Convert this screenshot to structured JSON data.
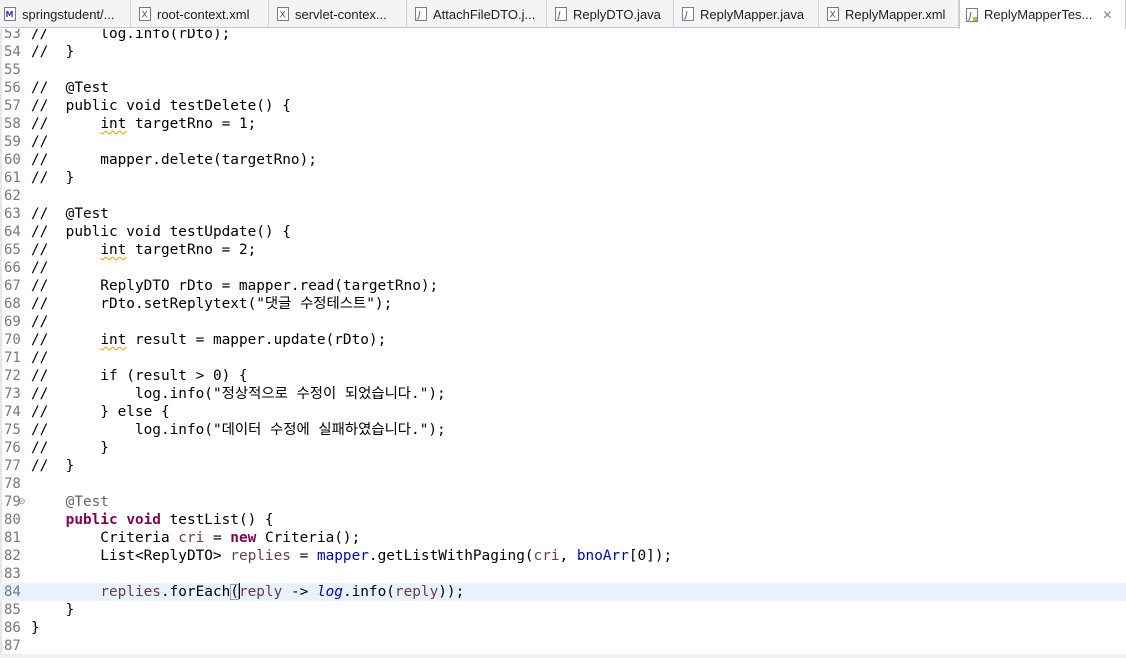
{
  "colors": {
    "keyword": "#7f0055",
    "annotation": "#646464",
    "field": "#0000c0",
    "local_variable": "#6a3e3e",
    "string": "#2a00ff",
    "current_line": "#e8f2fe",
    "line_number": "#787878"
  },
  "tabs": [
    {
      "label": "springstudent/...",
      "icon": "maven-pom-icon",
      "active": false
    },
    {
      "label": "root-context.xml",
      "icon": "xml-file-icon",
      "active": false
    },
    {
      "label": "servlet-contex...",
      "icon": "xml-file-icon",
      "active": false
    },
    {
      "label": "AttachFileDTO.j...",
      "icon": "java-file-icon",
      "active": false
    },
    {
      "label": "ReplyDTO.java",
      "icon": "java-file-icon",
      "active": false
    },
    {
      "label": "ReplyMapper.java",
      "icon": "java-file-icon",
      "active": false
    },
    {
      "label": "ReplyMapper.xml",
      "icon": "xml-file-icon",
      "active": false
    },
    {
      "label": "ReplyMapperTes...",
      "icon": "java-test-file-icon",
      "active": true,
      "close_icon": "close-icon"
    }
  ],
  "editor": {
    "current_line": 84,
    "lines": [
      {
        "n": "53",
        "fold": "",
        "tokens": [
          {
            "t": "//      log.info(rDto);",
            "c": "plain"
          }
        ]
      },
      {
        "n": "54",
        "fold": "",
        "tokens": [
          {
            "t": "//  }",
            "c": "plain"
          }
        ]
      },
      {
        "n": "55",
        "fold": "",
        "tokens": []
      },
      {
        "n": "56",
        "fold": "",
        "tokens": [
          {
            "t": "//  @Test",
            "c": "plain"
          }
        ]
      },
      {
        "n": "57",
        "fold": "",
        "tokens": [
          {
            "t": "//  public void testDelete() {",
            "c": "plain"
          }
        ]
      },
      {
        "n": "58",
        "fold": "",
        "tokens": [
          {
            "t": "//      ",
            "c": "plain"
          },
          {
            "t": "int",
            "c": "warn"
          },
          {
            "t": " targetRno = 1;",
            "c": "plain"
          }
        ]
      },
      {
        "n": "59",
        "fold": "",
        "tokens": [
          {
            "t": "//",
            "c": "plain"
          }
        ]
      },
      {
        "n": "60",
        "fold": "",
        "tokens": [
          {
            "t": "//      mapper.delete(targetRno);",
            "c": "plain"
          }
        ]
      },
      {
        "n": "61",
        "fold": "",
        "tokens": [
          {
            "t": "//  }",
            "c": "plain"
          }
        ]
      },
      {
        "n": "62",
        "fold": "",
        "tokens": []
      },
      {
        "n": "63",
        "fold": "",
        "tokens": [
          {
            "t": "//  @Test",
            "c": "plain"
          }
        ]
      },
      {
        "n": "64",
        "fold": "",
        "tokens": [
          {
            "t": "//  public void testUpdate() {",
            "c": "plain"
          }
        ]
      },
      {
        "n": "65",
        "fold": "",
        "tokens": [
          {
            "t": "//      ",
            "c": "plain"
          },
          {
            "t": "int",
            "c": "warn"
          },
          {
            "t": " targetRno = 2;",
            "c": "plain"
          }
        ]
      },
      {
        "n": "66",
        "fold": "",
        "tokens": [
          {
            "t": "//",
            "c": "plain"
          }
        ]
      },
      {
        "n": "67",
        "fold": "",
        "tokens": [
          {
            "t": "//      ReplyDTO rDto = mapper.read(targetRno);",
            "c": "plain"
          }
        ]
      },
      {
        "n": "68",
        "fold": "",
        "tokens": [
          {
            "t": "//      rDto.setReplytext(\"댓글 수정테스트\");",
            "c": "plain"
          }
        ]
      },
      {
        "n": "69",
        "fold": "",
        "tokens": [
          {
            "t": "//",
            "c": "plain"
          }
        ]
      },
      {
        "n": "70",
        "fold": "",
        "tokens": [
          {
            "t": "//      ",
            "c": "plain"
          },
          {
            "t": "int",
            "c": "warn"
          },
          {
            "t": " result = mapper.update(rDto);",
            "c": "plain"
          }
        ]
      },
      {
        "n": "71",
        "fold": "",
        "tokens": [
          {
            "t": "//",
            "c": "plain"
          }
        ]
      },
      {
        "n": "72",
        "fold": "",
        "tokens": [
          {
            "t": "//      if (result > 0) {",
            "c": "plain"
          }
        ]
      },
      {
        "n": "73",
        "fold": "",
        "tokens": [
          {
            "t": "//          log.info(\"정상적으로 수정이 되었습니다.\");",
            "c": "plain"
          }
        ]
      },
      {
        "n": "74",
        "fold": "",
        "tokens": [
          {
            "t": "//      } else {",
            "c": "plain"
          }
        ]
      },
      {
        "n": "75",
        "fold": "",
        "tokens": [
          {
            "t": "//          log.info(\"데이터 수정에 실패하였습니다.\");",
            "c": "plain"
          }
        ]
      },
      {
        "n": "76",
        "fold": "",
        "tokens": [
          {
            "t": "//      }",
            "c": "plain"
          }
        ]
      },
      {
        "n": "77",
        "fold": "",
        "tokens": [
          {
            "t": "//  }",
            "c": "plain"
          }
        ]
      },
      {
        "n": "78",
        "fold": "",
        "tokens": []
      },
      {
        "n": "79",
        "fold": "⊖",
        "tokens": [
          {
            "t": "    ",
            "c": "plain"
          },
          {
            "t": "@Test",
            "c": "ann"
          }
        ]
      },
      {
        "n": "80",
        "fold": "",
        "tokens": [
          {
            "t": "    ",
            "c": "plain"
          },
          {
            "t": "public",
            "c": "kw"
          },
          {
            "t": " ",
            "c": "plain"
          },
          {
            "t": "void",
            "c": "kw"
          },
          {
            "t": " testList() {",
            "c": "plain"
          }
        ]
      },
      {
        "n": "81",
        "fold": "",
        "tokens": [
          {
            "t": "        Criteria ",
            "c": "plain"
          },
          {
            "t": "cri",
            "c": "local"
          },
          {
            "t": " = ",
            "c": "plain"
          },
          {
            "t": "new",
            "c": "kw"
          },
          {
            "t": " Criteria();",
            "c": "plain"
          }
        ]
      },
      {
        "n": "82",
        "fold": "",
        "tokens": [
          {
            "t": "        List<ReplyDTO> ",
            "c": "plain"
          },
          {
            "t": "replies",
            "c": "local"
          },
          {
            "t": " = ",
            "c": "plain"
          },
          {
            "t": "mapper",
            "c": "field"
          },
          {
            "t": ".getListWithPaging(",
            "c": "plain"
          },
          {
            "t": "cri",
            "c": "local"
          },
          {
            "t": ", ",
            "c": "plain"
          },
          {
            "t": "bnoArr",
            "c": "field"
          },
          {
            "t": "[0]);",
            "c": "plain"
          }
        ]
      },
      {
        "n": "83",
        "fold": "",
        "tokens": []
      },
      {
        "n": "84",
        "fold": "",
        "tokens": [
          {
            "t": "        ",
            "c": "plain"
          },
          {
            "t": "replies",
            "c": "local"
          },
          {
            "t": ".forEach",
            "c": "plain"
          },
          {
            "t": "(",
            "c": "bracket"
          },
          {
            "t": "",
            "c": "cursor"
          },
          {
            "t": "reply",
            "c": "local"
          },
          {
            "t": " -> ",
            "c": "plain"
          },
          {
            "t": "log",
            "c": "static"
          },
          {
            "t": ".info(",
            "c": "plain"
          },
          {
            "t": "reply",
            "c": "local"
          },
          {
            "t": "));",
            "c": "plain"
          }
        ]
      },
      {
        "n": "85",
        "fold": "",
        "tokens": [
          {
            "t": "    }",
            "c": "plain"
          }
        ]
      },
      {
        "n": "86",
        "fold": "",
        "tokens": [
          {
            "t": "}",
            "c": "plain"
          }
        ]
      },
      {
        "n": "87",
        "fold": "",
        "tokens": []
      }
    ]
  }
}
